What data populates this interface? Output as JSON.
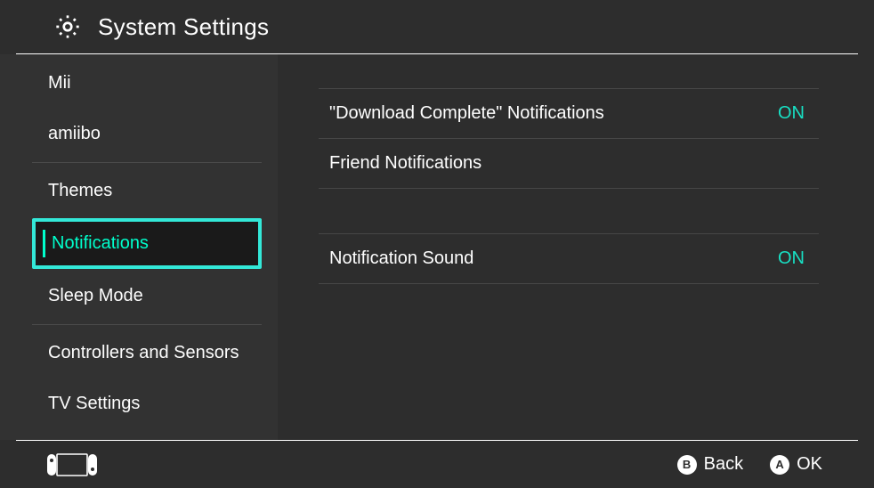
{
  "header": {
    "title": "System Settings"
  },
  "sidebar": {
    "items": [
      {
        "label": "Mii"
      },
      {
        "label": "amiibo"
      },
      {
        "label": "Themes"
      },
      {
        "label": "Notifications",
        "selected": true
      },
      {
        "label": "Sleep Mode"
      },
      {
        "label": "Controllers and Sensors"
      },
      {
        "label": "TV Settings"
      }
    ]
  },
  "content": {
    "groups": [
      {
        "rows": [
          {
            "label": "\"Download Complete\" Notifications",
            "value": "ON"
          },
          {
            "label": "Friend Notifications",
            "value": ""
          }
        ]
      },
      {
        "rows": [
          {
            "label": "Notification Sound",
            "value": "ON"
          }
        ]
      }
    ]
  },
  "footer": {
    "buttons": [
      {
        "glyph": "B",
        "label": "Back"
      },
      {
        "glyph": "A",
        "label": "OK"
      }
    ]
  },
  "colors": {
    "accent": "#00ffcc",
    "background": "#2d2d2d",
    "sidebar": "#323232"
  }
}
